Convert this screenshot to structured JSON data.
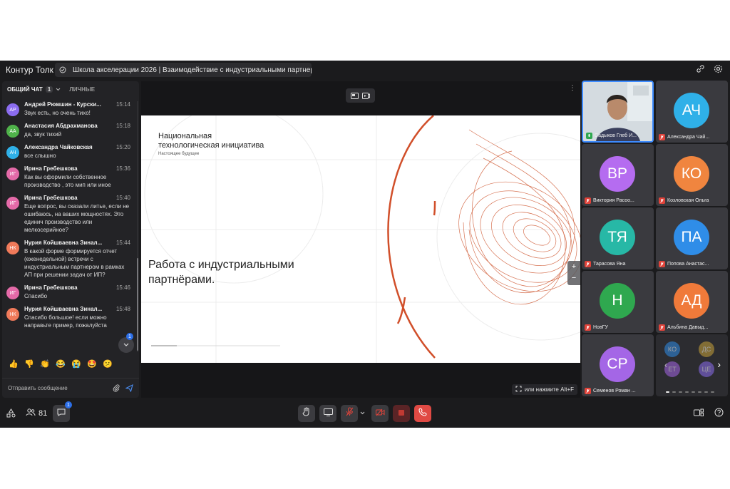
{
  "app": {
    "title": "Контур Толк",
    "meeting_title": "Школа акселерации 2026 | Взаимодействие с индустриальными партнерами в ..."
  },
  "chat": {
    "tab_general": "ОБЩИЙ ЧАТ",
    "tab_general_badge": "1",
    "tab_private": "ЛИЧНЫЕ",
    "unread_badge": "1",
    "composer_placeholder": "Отправить сообщение",
    "messages": [
      {
        "initials": "АР",
        "color": "#8b6cf0",
        "author": "Андрей Рюмшин - Курски...",
        "time": "15:14",
        "text": "Звук есть, но очень тихо!"
      },
      {
        "initials": "АА",
        "color": "#4fb24a",
        "author": "Анастасия Абдрахманова",
        "time": "15:18",
        "text": "да, звук тихий"
      },
      {
        "initials": "АЧ",
        "color": "#2fb0e8",
        "author": "Александра Чайковская",
        "time": "15:20",
        "text": "все слышно"
      },
      {
        "initials": "ИГ",
        "color": "#e46aa8",
        "author": "Ирина Гребешкова",
        "time": "15:36",
        "text": "Как вы оформили собственное производство , это мип или иное"
      },
      {
        "initials": "ИГ",
        "color": "#e46aa8",
        "author": "Ирина Гребешкова",
        "time": "15:40",
        "text": "Еще вопрос, вы сказали литье, если не ошибаюсь, на ваших мощностях. Это единич производство или мелкосерийное?"
      },
      {
        "initials": "НК",
        "color": "#f07a5a",
        "author": "Нурия Койшваевна Зинал...",
        "time": "15:44",
        "text": "В какой форме формируется отчет (еженедельной) встречи с индустриальным партнером в рамках АП при решении задач от ИП?"
      },
      {
        "initials": "ИГ",
        "color": "#e46aa8",
        "author": "Ирина Гребешкова",
        "time": "15:46",
        "text": "Спасибо"
      },
      {
        "initials": "НК",
        "color": "#f07a5a",
        "author": "Нурия Койшваевна Зинал...",
        "time": "15:48",
        "text": "Спасибо большое! если можно направьте пример, пожалуйста"
      }
    ],
    "reactions": [
      "👍",
      "👎",
      "👏",
      "😂",
      "😭",
      "🤩",
      "😕"
    ]
  },
  "slide": {
    "org_line1": "Национальная",
    "org_line2": "технологическая инициатива",
    "tagline": "Настоящее будущее",
    "title": "Работа с индустриальными партнёрами.",
    "hint": "или нажмите Alt+F"
  },
  "participants": {
    "count": "81",
    "tiles": [
      {
        "initials": "",
        "name": "Садыков Глеб И...",
        "color": "",
        "speaker": true
      },
      {
        "initials": "АЧ",
        "name": "Александра Чай...",
        "color": "#2fb0e8"
      },
      {
        "initials": "ВР",
        "name": "Виктория Расоо...",
        "color": "#b56cf0"
      },
      {
        "initials": "КО",
        "name": "Козловская Ольга",
        "color": "#f0853f"
      },
      {
        "initials": "ТЯ",
        "name": "Тарасова Яна",
        "color": "#27b8a6"
      },
      {
        "initials": "ПА",
        "name": "Попова Анастас...",
        "color": "#2f8de8"
      },
      {
        "initials": "Н",
        "name": "НовГУ",
        "color": "#2fa84f"
      },
      {
        "initials": "АД",
        "name": "Альбина Давыд...",
        "color": "#f07a3a"
      },
      {
        "initials": "СР",
        "name": "Семенов Роман ...",
        "color": "#a466e6"
      }
    ],
    "mini": [
      {
        "initials": "КО",
        "color": "#2f8de8"
      },
      {
        "initials": "ДС",
        "color": "#c9a33a"
      },
      {
        "initials": "ЕТ",
        "color": "#a466e6"
      },
      {
        "initials": "ЦЕ",
        "color": "#8b6cf0"
      }
    ]
  }
}
